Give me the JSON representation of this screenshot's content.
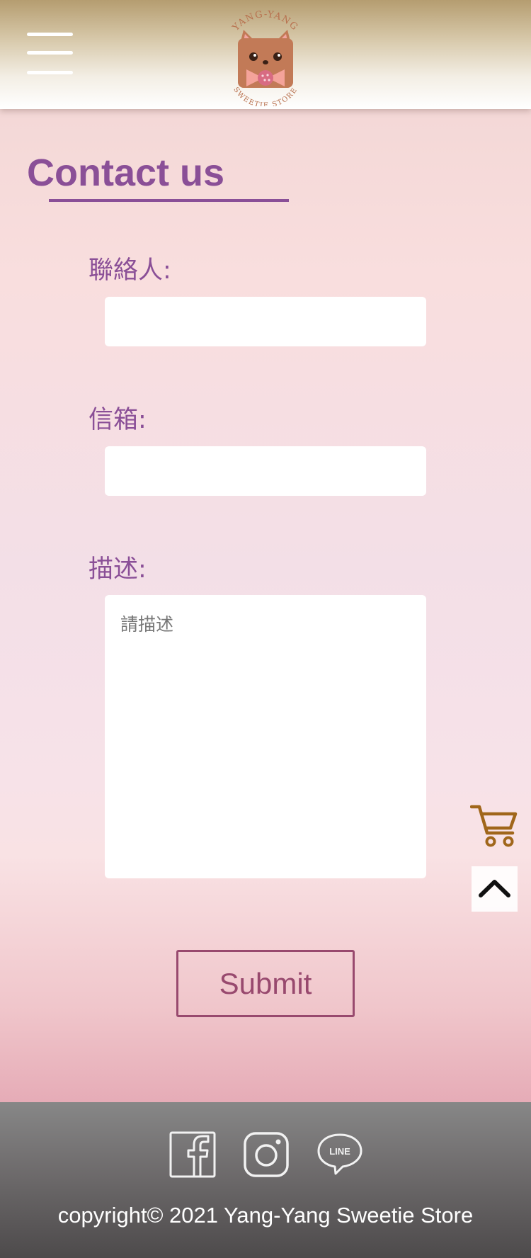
{
  "header": {
    "menu_icon": "hamburger-menu-icon",
    "logo": {
      "top_text": "YANG-YANG",
      "bottom_text": "SWEETIE STORE",
      "icon": "cat-with-bow-logo"
    }
  },
  "page": {
    "title": "Contact us"
  },
  "form": {
    "contact_label": "聯絡人:",
    "contact_value": "",
    "email_label": "信箱:",
    "email_value": "",
    "description_label": "描述:",
    "description_placeholder": "請描述",
    "description_value": "",
    "submit_label": "Submit"
  },
  "floating": {
    "cart_icon": "shopping-cart-icon",
    "cart_color": "#a0661a",
    "back_to_top_icon": "chevron-up-icon"
  },
  "footer": {
    "social_icons": [
      "facebook-icon",
      "instagram-icon",
      "line-icon"
    ],
    "line_text": "LINE",
    "copyright": "copyright© 2021 Yang-Yang Sweetie Store"
  },
  "colors": {
    "accent_purple": "#8a4f97",
    "submit_color": "#98496e",
    "header_gold": "#b59d70",
    "footer_gray": "#6e6b6c"
  }
}
